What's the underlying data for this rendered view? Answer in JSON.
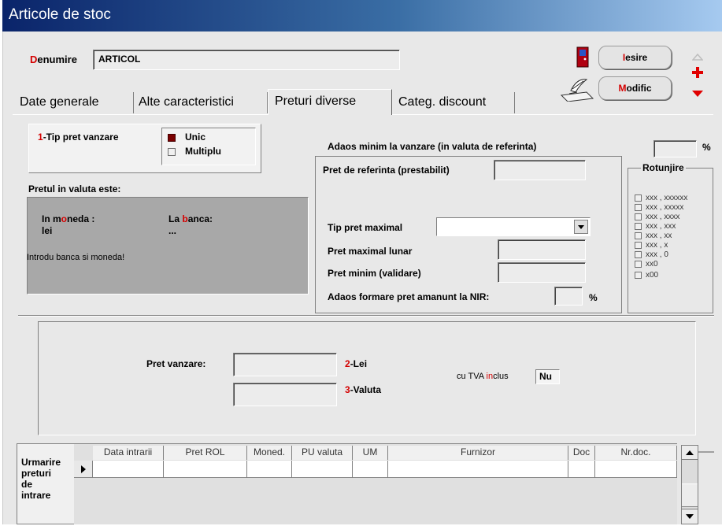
{
  "window": {
    "title": "Articole de stoc"
  },
  "header": {
    "denumire_label_first": "D",
    "denumire_label_rest": "enumire",
    "denumire_value": "ARTICOL"
  },
  "buttons": {
    "iesire_first": "I",
    "iesire_rest": "esire",
    "modific_first": "M",
    "modific_rest": "odific"
  },
  "tabs": [
    {
      "label": "Date generale"
    },
    {
      "label": "Alte caracteristici"
    },
    {
      "label": "Preturi diverse"
    },
    {
      "label": "Categ. discount"
    }
  ],
  "tip_pret": {
    "num": "1",
    "label": "-Tip pret vanzare",
    "option_unic": "Unic",
    "option_multiplu": "Multiplu",
    "selected": "Unic"
  },
  "valuta": {
    "title": "Pretul in valuta este:",
    "in_moneda_pre": "In m",
    "in_moneda_o": "o",
    "in_moneda_post": "neda :",
    "moneda_value": "lei",
    "la_banca_pre": "La ",
    "la_banca_b": "b",
    "la_banca_post": "anca:",
    "banca_value": "...",
    "hint": "Introdu banca si moneda!"
  },
  "adaos": {
    "adaos_minim_label": "Adaos minim la vanzare (in valuta de referinta)",
    "percent": "%",
    "pret_referinta_label": "Pret de referinta (prestabilit)",
    "tip_pret_maximal_label": "Tip pret maximal",
    "pret_maximal_lunar_label": "Pret maximal lunar",
    "pret_minim_label": "Pret minim (validare)",
    "adaos_formare_label": "Adaos formare pret amanunt la NIR:",
    "percent2": "%"
  },
  "rotunjire": {
    "title": "Rotunjire",
    "options": [
      "xxx , xxxxxx",
      "xxx , xxxxx",
      "xxx , xxxx",
      "xxx , xxx",
      "xxx , xx",
      "xxx , x",
      "xxx , 0",
      "xx0",
      "x00"
    ]
  },
  "pret_vanzare": {
    "label": "Pret vanzare:",
    "lei_num": "2",
    "lei_label": "-Lei",
    "valuta_num": "3",
    "valuta_label": "-Valuta",
    "tva_pre": "cu TVA ",
    "tva_in": "in",
    "tva_post": "clus",
    "tva_value": "Nu"
  },
  "urmarire": {
    "title_lines": [
      "Urmarire",
      "preturi",
      "de",
      "intrare"
    ],
    "columns": [
      "Data intrarii",
      "Pret ROL",
      "Moned.",
      "PU valuta",
      "UM",
      "Furnizor",
      "Doc",
      "Nr.doc."
    ]
  }
}
